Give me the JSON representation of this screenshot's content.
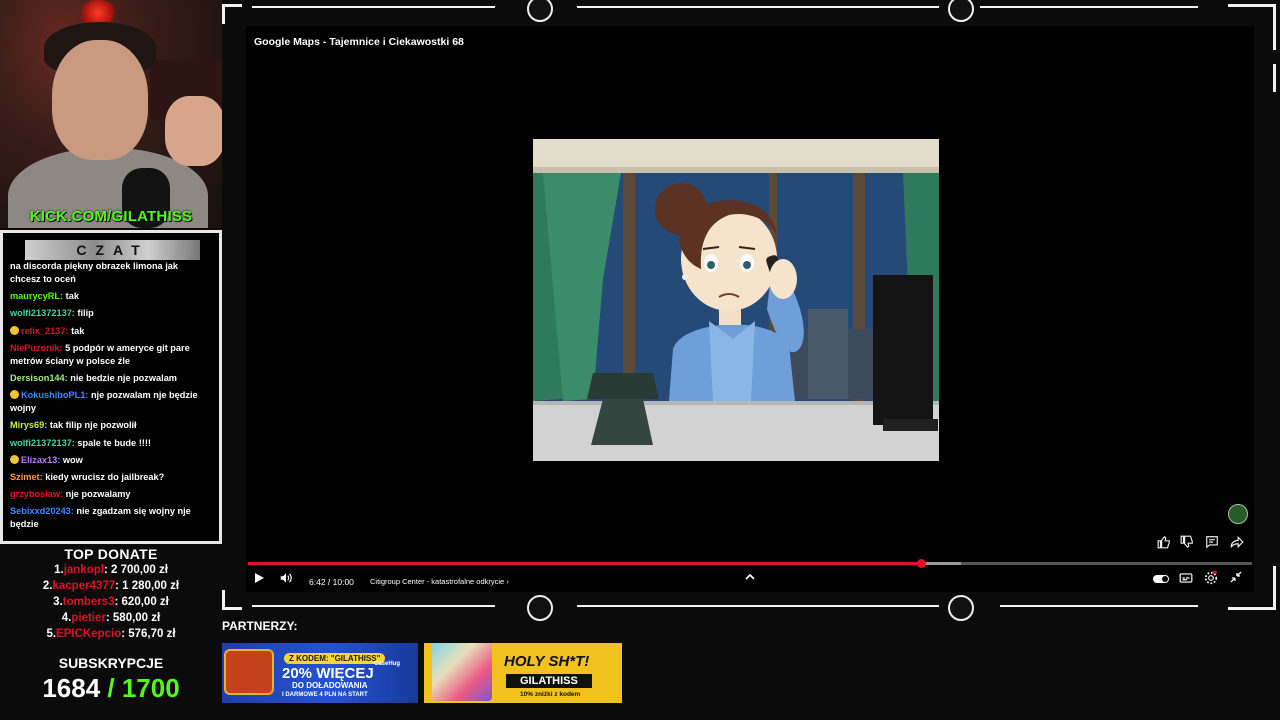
{
  "webcam": {
    "channel_url": "KICK.COM/GILATHISS"
  },
  "chat": {
    "header": "CZAT",
    "messages": [
      {
        "user": "",
        "text": "na discorda piękny obrazek limona jak chcesz to oceń",
        "color": "#ffffff",
        "emoji": false
      },
      {
        "user": "maurycyRL:",
        "text": " tak",
        "color": "#53fc18",
        "emoji": false
      },
      {
        "user": "wolfi21372137:",
        "text": " filip",
        "color": "#3fd9a8",
        "emoji": false
      },
      {
        "user": "relix_2137:",
        "text": " tak",
        "color": "#e0102a",
        "emoji": true
      },
      {
        "user": "NiePuzonik:",
        "text": " 5 podpór w ameryce git pare metrów ściany w polsce źle",
        "color": "#e0102a",
        "emoji": false
      },
      {
        "user": "Dersison144:",
        "text": " nie bedzie nje pozwalam",
        "color": "#9df27a",
        "emoji": false
      },
      {
        "user": "KokushiboPL1:",
        "text": " nje pozwalam nje będzie wojny",
        "color": "#3d8bff",
        "emoji": true
      },
      {
        "user": "Mirys69:",
        "text": " tak filip nje pozwolił",
        "color": "#c7f04a",
        "emoji": false
      },
      {
        "user": "wolfi21372137:",
        "text": " spale te bude !!!!",
        "color": "#3fd9a8",
        "emoji": false
      },
      {
        "user": "Elizax13:",
        "text": " wow",
        "color": "#b780ff",
        "emoji": true
      },
      {
        "user": "Szimet:",
        "text": " kiedy wrucisz do jailbreak?",
        "color": "#ff9b3d",
        "emoji": false
      },
      {
        "user": "grzybosław:",
        "text": " nje pozwalamy",
        "color": "#e0102a",
        "emoji": false
      },
      {
        "user": "Sebixxd20243:",
        "text": " nie zgadzam się wojny nje będzie",
        "color": "#3d8bff",
        "emoji": false
      }
    ]
  },
  "top_donate": {
    "title": "TOP DONATE",
    "entries": [
      {
        "rank": "1.",
        "name": "jankopl",
        "amount": ": 2 700,00 zł"
      },
      {
        "rank": "2.",
        "name": "kacper4377",
        "amount": ": 1 280,00 zł"
      },
      {
        "rank": "3.",
        "name": "tombers3",
        "amount": ": 620,00 zł"
      },
      {
        "rank": "4.",
        "name": "pietier",
        "amount": ": 580,00 zł"
      },
      {
        "rank": "5.",
        "name": "EPICKepcio",
        "amount": ": 576,70 zł"
      }
    ]
  },
  "subs": {
    "title": "SUBSKRYPCJE",
    "current": "1684",
    "goal": " / 1700"
  },
  "player": {
    "title": "Google Maps - Tajemnice i Ciekawostki 68",
    "time": "6:42 / 10:00",
    "chapter": "Citigroup Center - katastrofalne odkrycie",
    "progress": 0.67,
    "buffered": 0.71,
    "icons": {
      "like": "thumbs-up-icon",
      "dislike": "thumbs-down-icon",
      "comment": "comment-icon",
      "share": "share-icon",
      "play": "play-icon",
      "volume": "volume-icon",
      "up": "chevron-up-icon",
      "autoplay": "autoplay-toggle",
      "subtitles": "subtitles-icon",
      "settings": "gear-icon",
      "fullscreen": "exit-fullscreen-icon"
    }
  },
  "partners": {
    "label": "PARTNERZY:",
    "ad1": {
      "code": "Z KODEM: \"GILATHISS\"",
      "brand": "CaseHug",
      "headline": "20% WIĘCEJ",
      "line2": "DO DOŁADOWANIA",
      "line3": "I DARMOWE 4 PLN NA START"
    },
    "ad2": {
      "headline": "HOLY SH*T!",
      "code": "GILATHISS",
      "note": "10% zniżki z kodem"
    }
  },
  "colors": {
    "accent_green": "#53fc18",
    "accent_red": "#e0102a",
    "frame": "#f2f2f2"
  }
}
